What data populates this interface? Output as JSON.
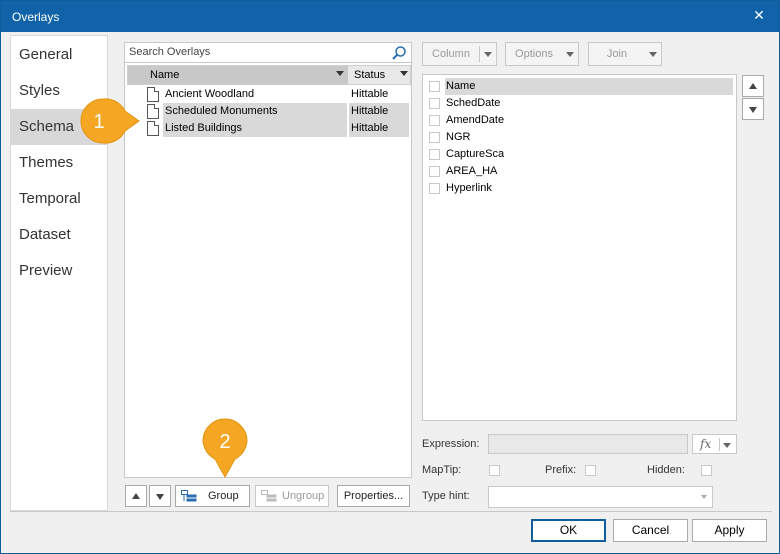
{
  "window": {
    "title": "Overlays",
    "close_glyph": "✕"
  },
  "nav": {
    "items": [
      {
        "label": "General",
        "active": false
      },
      {
        "label": "Styles",
        "active": false
      },
      {
        "label": "Schema",
        "active": true
      },
      {
        "label": "Themes",
        "active": false
      },
      {
        "label": "Temporal",
        "active": false
      },
      {
        "label": "Dataset",
        "active": false
      },
      {
        "label": "Preview",
        "active": false
      }
    ]
  },
  "overlays": {
    "search_placeholder": "Search Overlays",
    "columns": {
      "name": "Name",
      "status": "Status"
    },
    "rows": [
      {
        "name": "Ancient Woodland",
        "status": "Hittable",
        "selected": false
      },
      {
        "name": "Scheduled Monuments",
        "status": "Hittable",
        "selected": true
      },
      {
        "name": "Listed Buildings",
        "status": "Hittable",
        "selected": true
      }
    ]
  },
  "callouts": {
    "one": "1",
    "two": "2",
    "color": "#f5a623"
  },
  "left_toolbar": {
    "group": "Group",
    "ungroup": "Ungroup",
    "properties": "Properties..."
  },
  "right_toolbar": {
    "column": "Column",
    "options": "Options",
    "join": "Join"
  },
  "fields": [
    {
      "label": "Name",
      "selected": true
    },
    {
      "label": "SchedDate",
      "selected": false
    },
    {
      "label": "AmendDate",
      "selected": false
    },
    {
      "label": "NGR",
      "selected": false
    },
    {
      "label": "CaptureSca",
      "selected": false
    },
    {
      "label": "AREA_HA",
      "selected": false
    },
    {
      "label": "Hyperlink",
      "selected": false
    }
  ],
  "properties": {
    "expression_label": "Expression:",
    "fx_label": "fx",
    "maptip_label": "MapTip:",
    "prefix_label": "Prefix:",
    "hidden_label": "Hidden:",
    "typehint_label": "Type hint:"
  },
  "dialog_buttons": {
    "ok": "OK",
    "cancel": "Cancel",
    "apply": "Apply"
  },
  "colors": {
    "titlebar": "#1063a8",
    "selection": "#d9d9d9",
    "callout": "#f5a623"
  }
}
